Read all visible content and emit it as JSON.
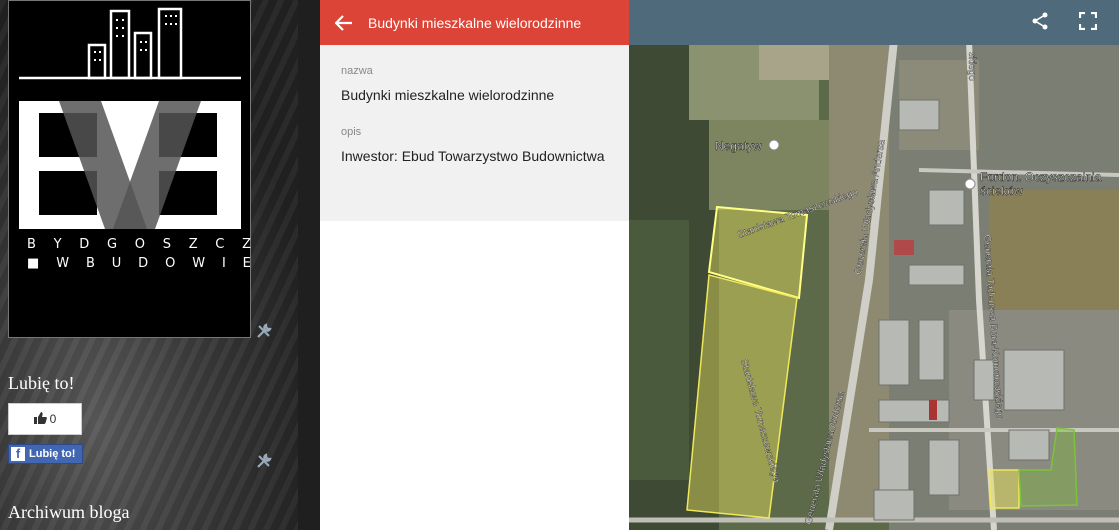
{
  "blog": {
    "brand_line1": [
      "B",
      "Y",
      "D",
      "G",
      "O",
      "S",
      "Z",
      "C",
      "Z"
    ],
    "brand_line2": [
      "■",
      "W",
      "B",
      "U",
      "D",
      "O",
      "W",
      "I",
      "E"
    ],
    "like_title": "Lubię to!",
    "like_count": "0",
    "fb_button_label": "Lubię to!",
    "archive_title": "Archiwum bloga"
  },
  "panel": {
    "title": "Budynki mieszkalne wielorodzinne",
    "name_label": "nazwa",
    "name_value": "Budynki mieszkalne wielorodzinne",
    "desc_label": "opis",
    "desc_value": "Inwestor: Ebud Towarzystwo Budownictwa"
  },
  "map": {
    "labels": {
      "negatyw": "Negatyw",
      "fordon1": "Fordon. Oczyszczalnia",
      "fordon2": "ścieków",
      "tomaszewskiego_top": "Stanisława Tomaszewskiego",
      "tomaszewskiego_mid": "Stanisława Tomaszewskiego",
      "andersa_top": "Generała Władysława Andersa",
      "andersa_bottom": "Generała Władysława Andersa",
      "bora": "Generała Tadeusza Bora-Komorowskiego",
      "skiego_top": "skiego"
    },
    "colors": {
      "polygon_yellow": "#e6e05a",
      "polygon_green": "#7bb33a",
      "header": "#4e6a7b"
    }
  }
}
